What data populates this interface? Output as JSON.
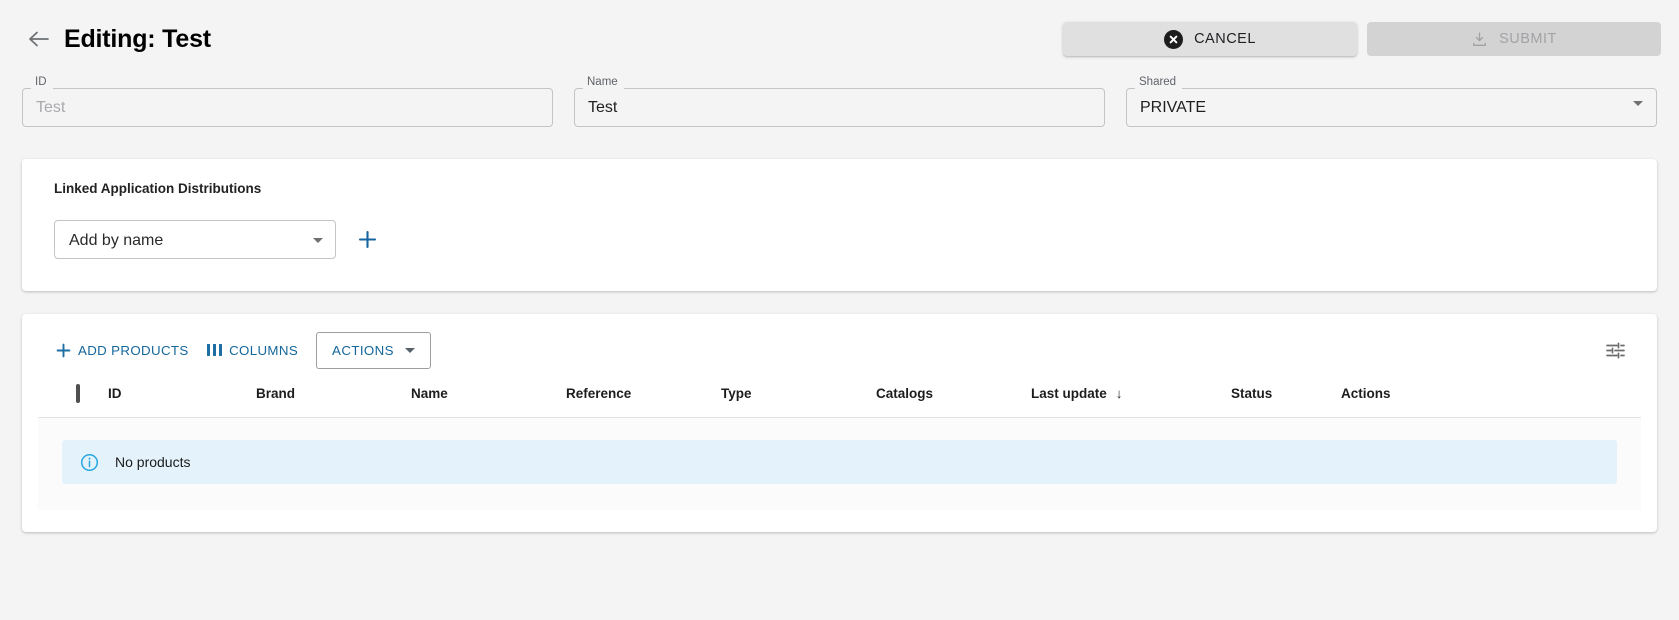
{
  "header": {
    "back_icon": "arrow-left-icon",
    "title": "Editing: Test",
    "cancel_label": "CANCEL",
    "cancel_icon": "cancel-circle-icon",
    "submit_label": "SUBMIT",
    "submit_icon": "save-download-icon",
    "submit_disabled": true
  },
  "form": {
    "id_field": {
      "label": "ID",
      "value": "Test",
      "is_placeholder": true
    },
    "name_field": {
      "label": "Name",
      "value": "Test",
      "is_placeholder": false
    },
    "shared_field": {
      "label": "Shared",
      "value": "PRIVATE",
      "options": [
        "PRIVATE"
      ]
    }
  },
  "linked_section": {
    "heading": "Linked Application Distributions",
    "add_select_value": "Add by name",
    "add_button_icon": "plus-icon"
  },
  "products_section": {
    "toolbar": {
      "add_products_label": "ADD PRODUCTS",
      "add_products_icon": "plus-icon",
      "columns_label": "COLUMNS",
      "columns_icon": "view-column-icon",
      "actions_label": "ACTIONS",
      "actions_caret_icon": "chevron-down-icon",
      "settings_icon": "tune-icon"
    },
    "table": {
      "columns": [
        {
          "key": "select",
          "label": ""
        },
        {
          "key": "id",
          "label": "ID"
        },
        {
          "key": "brand",
          "label": "Brand"
        },
        {
          "key": "name",
          "label": "Name"
        },
        {
          "key": "reference",
          "label": "Reference"
        },
        {
          "key": "type",
          "label": "Type"
        },
        {
          "key": "catalogs",
          "label": "Catalogs"
        },
        {
          "key": "last_update",
          "label": "Last update"
        },
        {
          "key": "status",
          "label": "Status"
        },
        {
          "key": "actions",
          "label": "Actions"
        }
      ],
      "sorted_column": "last_update",
      "sort_arrow": "↓",
      "rows": [],
      "empty_message": "No products",
      "empty_icon": "info-circle-icon"
    }
  },
  "colors": {
    "page_background": "#f4f4f5",
    "card_background": "#ffffff",
    "accent_blue": "#14679b",
    "info_background": "#e4f3fb",
    "info_icon": "#29a6e0",
    "disabled_grey": "#d3d3d4"
  }
}
